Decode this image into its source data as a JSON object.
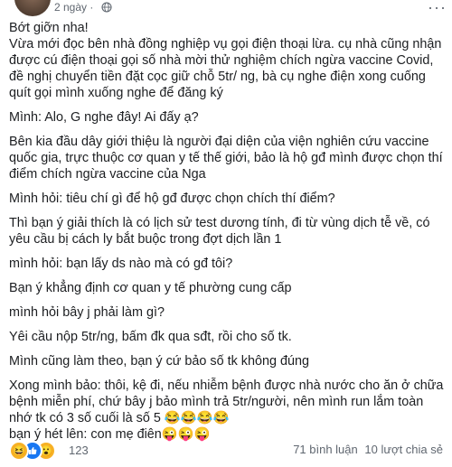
{
  "header": {
    "time": "2 ngày ·"
  },
  "post": {
    "paragraphs": [
      "Bớt giỡn nha!\nVừa mới đọc bên nhà đồng nghiệp vụ gọi điện thoại lừa. cụ nhà cũng nhận được cú điện thoại gọi số nhà mời thử nghiệm chích ngừa vaccine Covid, đề nghị chuyển tiền đặt cọc giữ chỗ 5tr/ ng, bà cụ nghe điện xong cuống quít gọi mình xuống nghe để đăng ký",
      "Mình: Alo, G nghe đây! Ai đấy ạ?",
      "Bên kia đầu dây giới thiệu là người đại diện của viện nghiên cứu vaccine quốc gia, trực thuộc cơ quan y tế thế giới, bảo là hộ gđ mình được chọn thí điểm chích ngừa vaccine của Nga",
      "Mình hỏi: tiêu chí gì để hộ gđ được chọn chích thí điểm?",
      "Thì bạn ý giải thích là có lịch sử test dương tính, đi từ vùng dịch tễ về, có yêu cầu bị cách ly bắt buộc trong đợt dịch lần 1",
      "mình hỏi: bạn lấy ds nào mà có gđ tôi?",
      "Bạn ý khẳng định cơ quan y tế phường cung cấp",
      "mình hỏi bây j phải làm gì?",
      "Yêi cầu nộp 5tr/ng, bấm đk qua sđt, rồi cho số tk.",
      "Mình cũng làm theo, bạn ý cứ bảo số tk không đúng",
      "Xong mình bảo: thôi, kệ đi, nếu nhiễm bệnh được nhà nước cho ăn ở chữa bệnh miễn phí, chứ bây j bảo mình trả 5tr/người, nên mình run lắm toàn nhớ tk có 3 số cuối là số 5 😂😂😂😂",
      "bạn ý hét lên: con mẹ điên😜😜😜"
    ]
  },
  "footer": {
    "reaction_count": "123",
    "comments": "71 bình luận",
    "shares": "10 lượt chia sẻ"
  }
}
